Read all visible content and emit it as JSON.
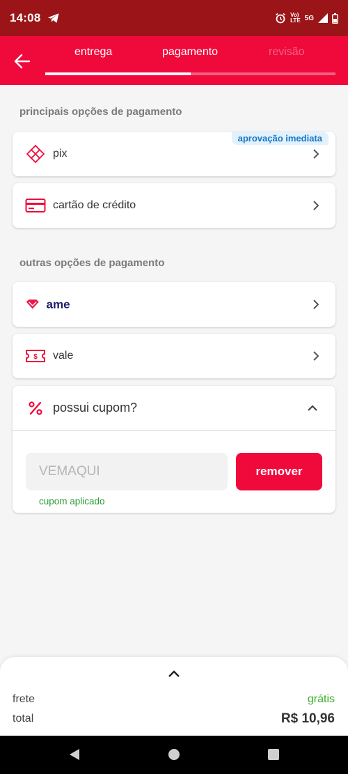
{
  "status_bar": {
    "time": "14:08",
    "volte_line1": "Vo)",
    "volte_line2": "LTE",
    "network": "5G"
  },
  "header": {
    "steps": [
      {
        "label": "entrega",
        "state": "done"
      },
      {
        "label": "pagamento",
        "state": "active"
      },
      {
        "label": "revisão",
        "state": "pending"
      }
    ],
    "progress_fraction": 0.5
  },
  "main_section": {
    "title": "principais opções de pagamento",
    "options": [
      {
        "label": "pix",
        "icon": "pix-icon",
        "badge": "aprovação imediata"
      },
      {
        "label": "cartão de crédito",
        "icon": "credit-card-icon"
      }
    ]
  },
  "other_section": {
    "title": "outras opções de pagamento",
    "options": [
      {
        "label": "ame",
        "icon": "ame-logo"
      },
      {
        "label": "vale",
        "icon": "voucher-icon"
      }
    ]
  },
  "coupon": {
    "title": "possui cupom?",
    "code": "VEMAQUI",
    "remove_label": "remover",
    "status": "cupom aplicado"
  },
  "summary": {
    "frete_label": "frete",
    "frete_value": "grátis",
    "total_label": "total",
    "total_value": "R$ 10,96"
  },
  "colors": {
    "brand_red": "#f00a3c",
    "status_bar": "#9b1518",
    "success_green": "#2a9d33",
    "badge_blue": "#1577c7"
  }
}
